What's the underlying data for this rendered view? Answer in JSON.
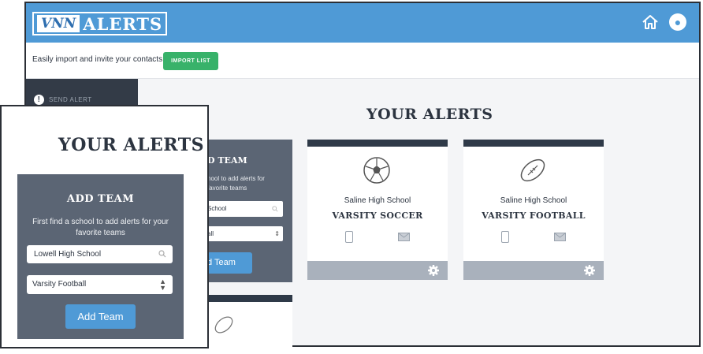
{
  "app": {
    "logo_vnn": "VNN",
    "logo_alerts": "ALERTS"
  },
  "icons": {
    "home": "home-icon",
    "user": "user-icon",
    "search": "search-icon",
    "gear": "gear-icon",
    "phone": "phone-icon",
    "mail": "mail-icon",
    "soccer": "soccer-ball-icon",
    "football": "football-icon"
  },
  "import_bar": {
    "text": "Easily import and invite your contacts.",
    "button": "IMPORT LIST"
  },
  "sidebar": {
    "send_alert": "SEND ALERT"
  },
  "main": {
    "title": "YOUR ALERTS"
  },
  "add_team_back": {
    "title": "D TEAM",
    "desc_line1": "hool to add alerts for",
    "desc_line2": "favorite teams",
    "search_value": "School",
    "select_value": "all",
    "button": "d Team"
  },
  "cards": [
    {
      "school": "Saline High School",
      "team": "VARSITY SOCCER",
      "icon": "soccer-ball-icon"
    },
    {
      "school": "Saline High School",
      "team": "VARSITY FOOTBALL",
      "icon": "football-icon"
    }
  ],
  "zoom": {
    "title": "YOUR ALERTS",
    "panel_title": "ADD TEAM",
    "description": "First find a school to add alerts for your favorite teams",
    "search_value": "Lowell High School",
    "select_value": "Varsity Football",
    "button": "Add Team"
  },
  "colors": {
    "header": "#4f9ad6",
    "import_button": "#38b26a",
    "sidebar": "#333b47",
    "panel": "#5b6574",
    "card_top": "#2f3a48",
    "card_footer": "#a9b1bc"
  }
}
